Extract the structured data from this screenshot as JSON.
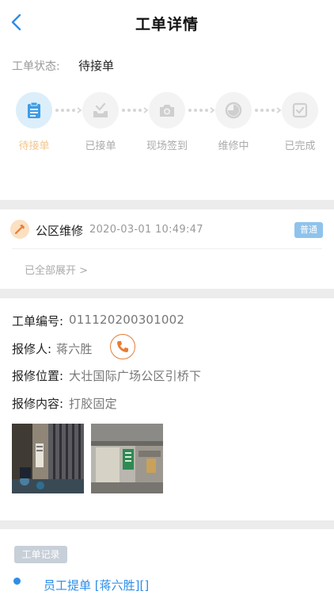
{
  "header": {
    "title": "工单详情",
    "back_icon": "chevron-left-icon"
  },
  "status": {
    "label": "工单状态:",
    "value": "待接单",
    "steps": [
      {
        "label": "待接单",
        "icon": "clipboard-icon",
        "active": true
      },
      {
        "label": "已接单",
        "icon": "inbox-check-icon",
        "active": false
      },
      {
        "label": "现场签到",
        "icon": "camera-icon",
        "active": false
      },
      {
        "label": "维修中",
        "icon": "progress-icon",
        "active": false
      },
      {
        "label": "已完成",
        "icon": "checkbox-icon",
        "active": false
      }
    ],
    "colors": {
      "active_bg": "#dceefa",
      "active_icon": "#3d9ce6",
      "active_label": "#f3c78c",
      "inactive": "#cfcfcf"
    }
  },
  "order": {
    "type": "公区维修",
    "time": "2020-03-01 10:49:47",
    "priority": "普通",
    "expand": "已全部展开 >",
    "icon": "hammer-icon"
  },
  "detail": {
    "number_label": "工单编号:",
    "number_value": "011120200301002",
    "reporter_label": "报修人:",
    "reporter_value": "蒋六胜",
    "location_label": "报修位置:",
    "location_value": "大壮国际广场公区引桥下",
    "content_label": "报修内容:",
    "content_value": "打胶固定",
    "phone_icon": "phone-icon",
    "phone_color": "#e97c35"
  },
  "records": {
    "badge": "工单记录",
    "items": [
      {
        "text": "员工提单 [蒋六胜][]"
      }
    ],
    "accent": "#2d8ee8"
  }
}
